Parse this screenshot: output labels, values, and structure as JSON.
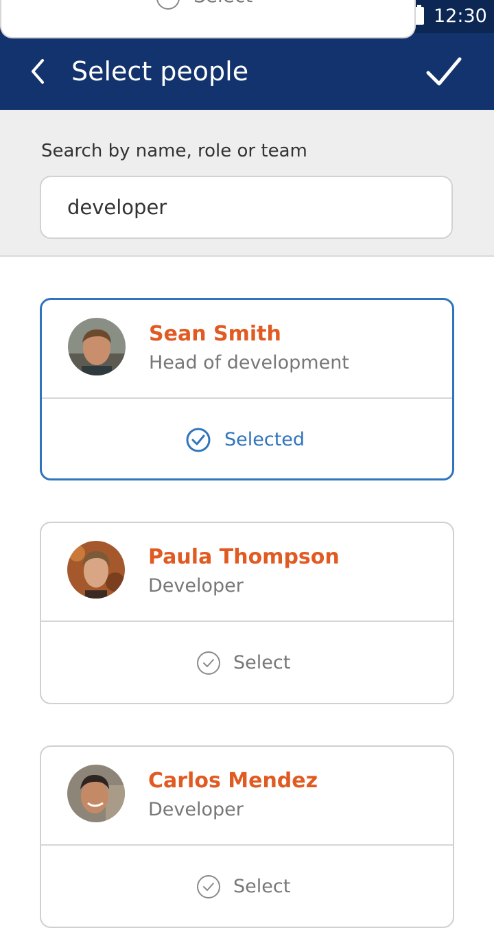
{
  "status_bar": {
    "time": "12:30"
  },
  "behind_sheet": {
    "label": "Select"
  },
  "app_bar": {
    "title": "Select people"
  },
  "search": {
    "label": "Search by name, role or team",
    "value": "developer"
  },
  "people": [
    {
      "name": "Sean Smith",
      "role": "Head of development",
      "action_label": "Selected",
      "selected": true
    },
    {
      "name": "Paula Thompson",
      "role": "Developer",
      "action_label": "Select",
      "selected": false
    },
    {
      "name": "Carlos Mendez",
      "role": "Developer",
      "action_label": "Select",
      "selected": false
    }
  ],
  "colors": {
    "app_bar": "#12336e",
    "status_bar": "#0c2753",
    "name": "#e05a22",
    "selected_accent": "#2f74bd",
    "role": "#777777"
  }
}
